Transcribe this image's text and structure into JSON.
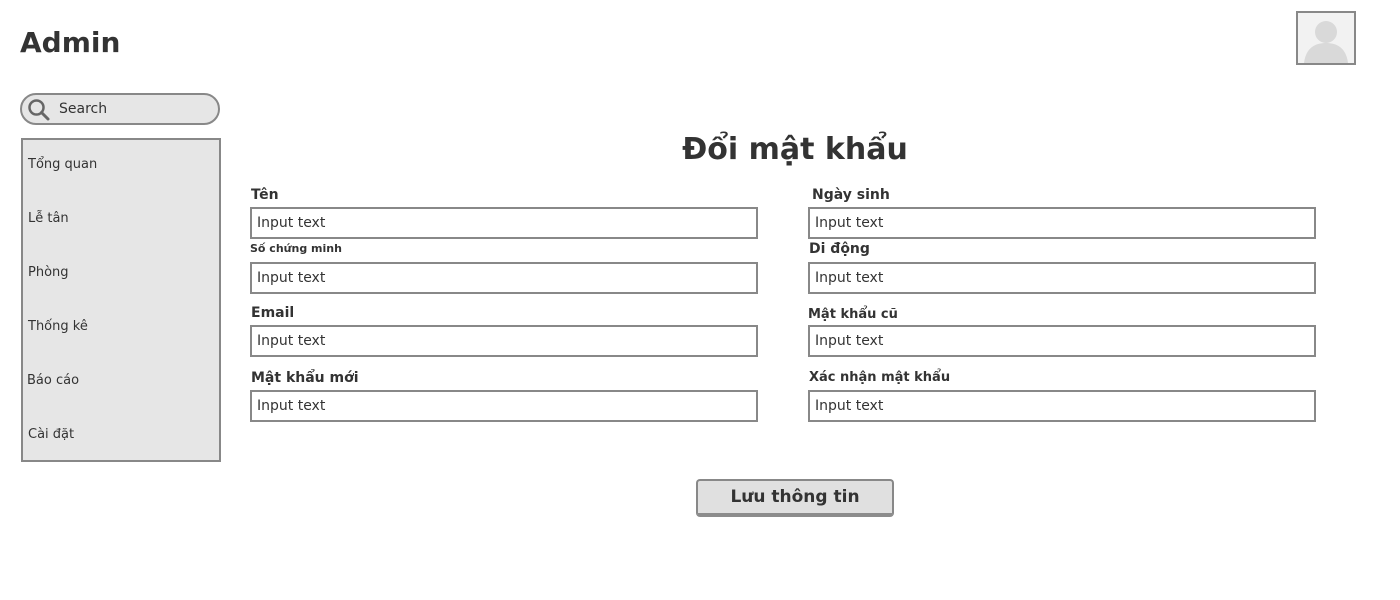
{
  "app": {
    "title": "Admin"
  },
  "header": {
    "avatar_icon": "user-avatar-placeholder"
  },
  "search": {
    "placeholder": "Search",
    "icon": "search-icon"
  },
  "sidebar": {
    "items": [
      {
        "label": "Tổng quan"
      },
      {
        "label": "Lễ tân"
      },
      {
        "label": "Phòng"
      },
      {
        "label": "Thống kê"
      },
      {
        "label": "Báo cáo"
      },
      {
        "label": "Cài đặt"
      }
    ]
  },
  "form": {
    "title": "Đổi mật khẩu",
    "fields": {
      "name": {
        "label": "Tên",
        "value": "Input text"
      },
      "birthday": {
        "label": "Ngày sinh",
        "value": "Input text"
      },
      "id_number": {
        "label": "Số chứng minh",
        "value": "Input text"
      },
      "mobile": {
        "label": "Di động",
        "value": "Input text"
      },
      "email": {
        "label": "Email",
        "value": "Input text"
      },
      "old_password": {
        "label": "Mật khẩu cũ",
        "value": "Input text"
      },
      "new_password": {
        "label": "Mật khẩu mới",
        "value": "Input text"
      },
      "confirm_password": {
        "label": "Xác nhận mật khẩu",
        "value": "Input text"
      }
    },
    "save_label": "Lưu thông tin"
  },
  "colors": {
    "panel_bg": "#e6e6e6",
    "border": "#888888",
    "text": "#333333"
  }
}
